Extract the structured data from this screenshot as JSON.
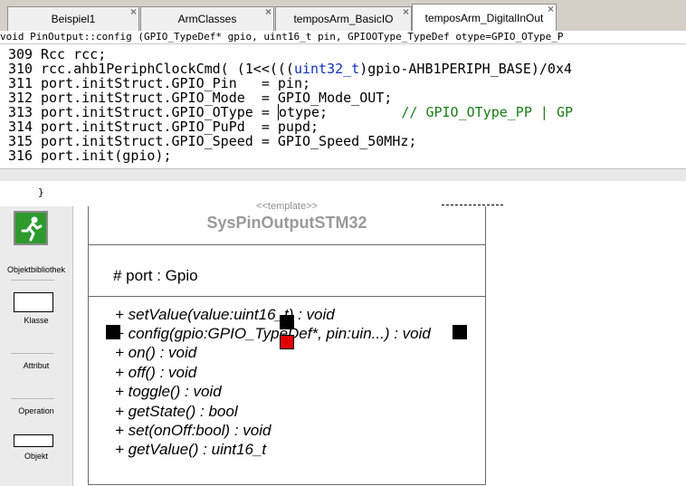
{
  "tabs": [
    {
      "label": "Beispiel1",
      "close": "×"
    },
    {
      "label": "ArmClasses",
      "close": "×"
    },
    {
      "label": "temposArm_BasicIO",
      "close": "×"
    },
    {
      "label": "temposArm_DigitalInOut",
      "close": "×"
    }
  ],
  "signature": "void PinOutput::config (GPIO_TypeDef* gpio, uint16_t pin, GPIOOType_TypeDef otype=GPIO_OType_P",
  "code": {
    "lines": [
      {
        "num": "309",
        "text": "Rcc rcc;"
      },
      {
        "num": "310",
        "pre": "rcc.ahb1PeriphClockCmd( (1<<(((",
        "kw": "uint32_t",
        "post": ")gpio-AHB1PERIPH_BASE)/0x4"
      },
      {
        "num": "311",
        "text": "port.initStruct.GPIO_Pin   = pin;"
      },
      {
        "num": "312",
        "text": "port.initStruct.GPIO_Mode  = GPIO_Mode_OUT;"
      },
      {
        "num": "313",
        "pre": "port.initStruct.GPIO_OType = ",
        "cur": "o",
        "post": "type;         ",
        "comment": "// GPIO_OType_PP | GP"
      },
      {
        "num": "314",
        "text": "port.initStruct.GPIO_PuPd  = pupd;"
      },
      {
        "num": "315",
        "text": "port.initStruct.GPIO_Speed = GPIO_Speed_50MHz;"
      },
      {
        "num": "316",
        "text": "port.init(gpio);"
      }
    ]
  },
  "brace": "}",
  "toolbox": {
    "objektbibliothek": "Objektbibliothek",
    "klasse": "Klasse",
    "attribut": "Attribut",
    "operation": "Operation",
    "objekt": "Objekt"
  },
  "uml": {
    "stereotype": "<<template>>",
    "classname": "SysPinOutputSTM32",
    "attribute": "# port : Gpio",
    "operations": [
      "+ setValue(value:uint16_t) : void",
      "+ config(gpio:GPIO_TypeDef*, pin:uin...) : void",
      "+ on() : void",
      "+ off() : void",
      "+ toggle() : void",
      "+ getState() : bool",
      "+ set(onOff:bool) : void",
      "+ getValue() : uint16_t"
    ]
  },
  "colors": {
    "keyword": "#1030b8",
    "comment": "#1a7d1a",
    "selection_handle": "#000000",
    "selection_handle_active": "#e00000"
  }
}
